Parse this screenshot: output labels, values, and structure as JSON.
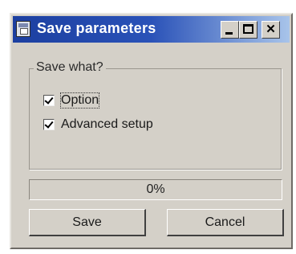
{
  "window": {
    "title": "Save parameters"
  },
  "titlebar": {
    "icon": "save-app-icon",
    "controls": [
      "minimize",
      "maximize",
      "close"
    ],
    "close_glyph": "✕"
  },
  "group": {
    "label": "Save what?",
    "options": [
      {
        "label": "Option",
        "checked": true
      },
      {
        "label": "Advanced setup",
        "checked": true
      }
    ]
  },
  "progress": {
    "text": "0%",
    "value": 0
  },
  "buttons": {
    "save_label": "Save",
    "cancel_label": "Cancel"
  },
  "colors": {
    "titlebar_start": "#1c3fa0",
    "titlebar_end": "#a8c4ea",
    "face": "#d4d0c8"
  }
}
